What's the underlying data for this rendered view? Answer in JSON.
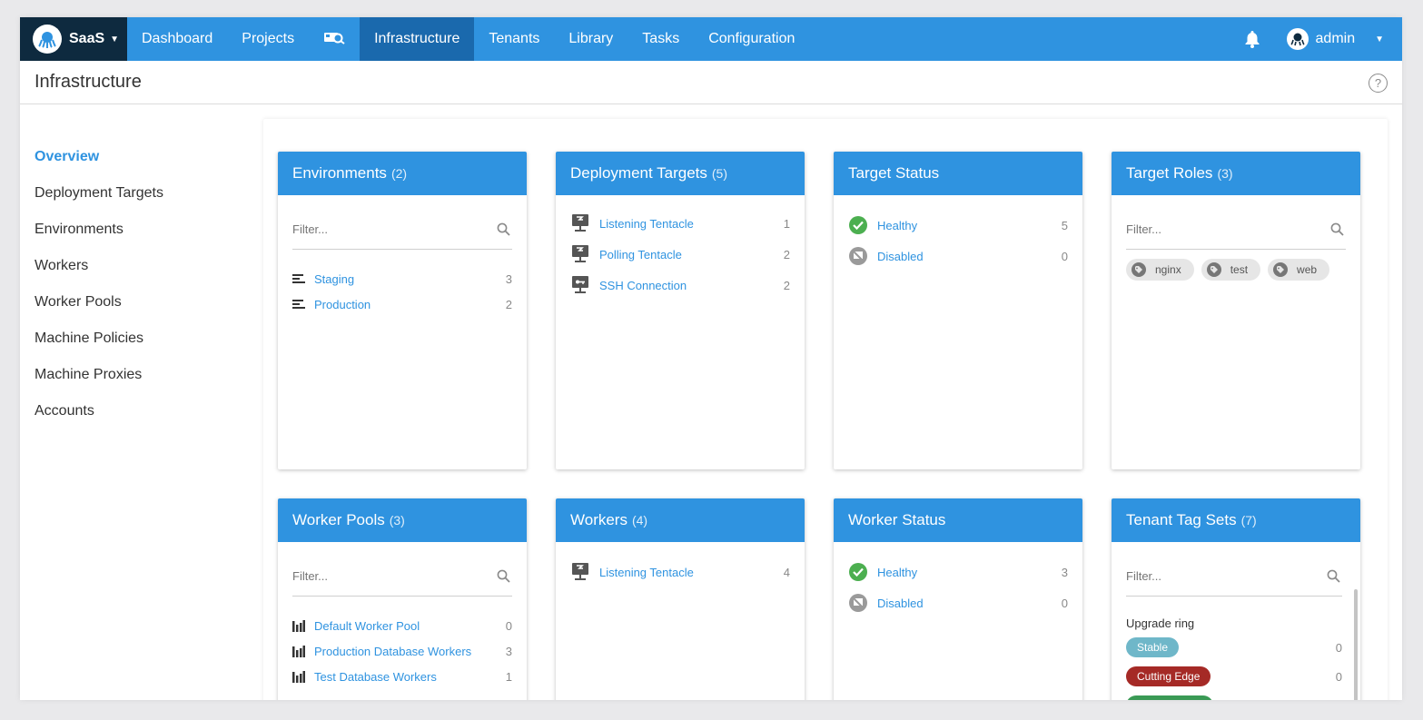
{
  "nav": {
    "brand": "SaaS",
    "items": [
      "Dashboard",
      "Projects",
      "Infrastructure",
      "Tenants",
      "Library",
      "Tasks",
      "Configuration"
    ],
    "active": "Infrastructure",
    "user": "admin"
  },
  "page": {
    "title": "Infrastructure"
  },
  "sidebar": {
    "items": [
      "Overview",
      "Deployment Targets",
      "Environments",
      "Workers",
      "Worker Pools",
      "Machine Policies",
      "Machine Proxies",
      "Accounts"
    ],
    "active": "Overview"
  },
  "filter_placeholder": "Filter...",
  "cards": {
    "environments": {
      "title": "Environments",
      "count": "(2)",
      "items": [
        {
          "label": "Staging",
          "count": "3"
        },
        {
          "label": "Production",
          "count": "2"
        }
      ]
    },
    "deployment_targets": {
      "title": "Deployment Targets",
      "count": "(5)",
      "items": [
        {
          "label": "Listening Tentacle",
          "count": "1"
        },
        {
          "label": "Polling Tentacle",
          "count": "2"
        },
        {
          "label": "SSH Connection",
          "count": "2"
        }
      ]
    },
    "target_status": {
      "title": "Target Status",
      "items": [
        {
          "label": "Healthy",
          "count": "5"
        },
        {
          "label": "Disabled",
          "count": "0"
        }
      ]
    },
    "target_roles": {
      "title": "Target Roles",
      "count": "(3)",
      "tags": [
        "nginx",
        "test",
        "web"
      ]
    },
    "worker_pools": {
      "title": "Worker Pools",
      "count": "(3)",
      "items": [
        {
          "label": "Default Worker Pool",
          "count": "0"
        },
        {
          "label": "Production Database Workers",
          "count": "3"
        },
        {
          "label": "Test Database Workers",
          "count": "1"
        }
      ]
    },
    "workers": {
      "title": "Workers",
      "count": "(4)",
      "items": [
        {
          "label": "Listening Tentacle",
          "count": "4"
        }
      ]
    },
    "worker_status": {
      "title": "Worker Status",
      "items": [
        {
          "label": "Healthy",
          "count": "3"
        },
        {
          "label": "Disabled",
          "count": "0"
        }
      ]
    },
    "tenant_tag_sets": {
      "title": "Tenant Tag Sets",
      "count": "(7)",
      "group": "Upgrade ring",
      "tags": [
        {
          "label": "Stable",
          "count": "0",
          "color": "#6fb7c9"
        },
        {
          "label": "Cutting Edge",
          "count": "0",
          "color": "#a52a26"
        }
      ]
    }
  },
  "colors": {
    "primary": "#2f93e0",
    "nav_active": "#1a69ad",
    "brand_bg": "#0e2a3f",
    "healthy": "#4caf50"
  }
}
